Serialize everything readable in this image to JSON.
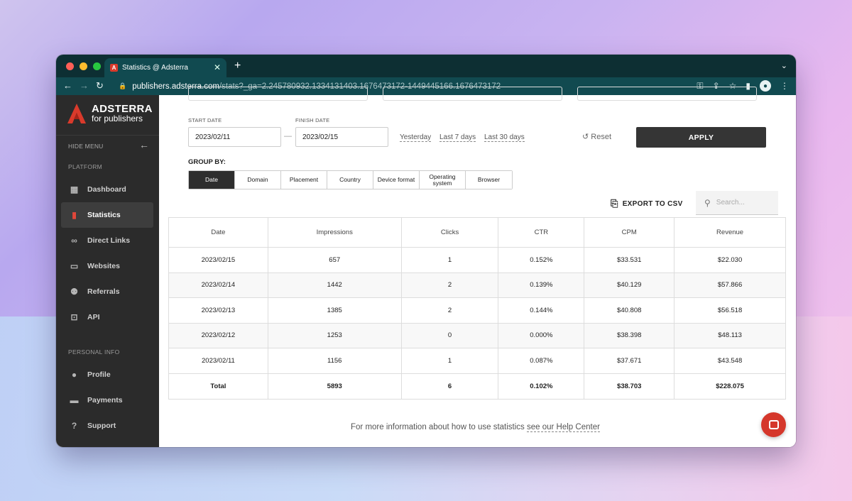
{
  "browser": {
    "tab_title": "Statistics @ Adsterra",
    "tab_favicon": "A",
    "url_host": "publishers.adsterra.com",
    "url_path": "/stats?_ga=2.245780932.1334131403.1676473172-1449445166.1676473172"
  },
  "sidebar": {
    "logo_name": "ADSTERRA",
    "logo_sub": "for publishers",
    "hide_menu": "HIDE MENU",
    "platform_label": "PLATFORM",
    "platform_items": [
      {
        "label": "Dashboard",
        "icon": "dashboard-icon"
      },
      {
        "label": "Statistics",
        "icon": "bar-chart-icon"
      },
      {
        "label": "Direct Links",
        "icon": "link-icon"
      },
      {
        "label": "Websites",
        "icon": "monitor-icon"
      },
      {
        "label": "Referrals",
        "icon": "users-icon"
      },
      {
        "label": "API",
        "icon": "terminal-icon"
      }
    ],
    "personal_label": "PERSONAL INFO",
    "personal_items": [
      {
        "label": "Profile",
        "icon": "user-circle-icon"
      },
      {
        "label": "Payments",
        "icon": "credit-card-icon"
      },
      {
        "label": "Support",
        "icon": "help-icon"
      }
    ]
  },
  "filters": {
    "start_label": "START DATE",
    "start_value": "2023/02/11",
    "finish_label": "FINISH DATE",
    "finish_value": "2023/02/15",
    "dash": "—",
    "quick": [
      "Yesterday",
      "Last 7 days",
      "Last 30 days"
    ],
    "reset_label": "Reset",
    "apply_label": "APPLY"
  },
  "group_by": {
    "label": "GROUP BY:",
    "options": [
      "Date",
      "Domain",
      "Placement",
      "Country",
      "Device format",
      "Operating system",
      "Browser"
    ],
    "selected": "Date"
  },
  "actions": {
    "export_label": "EXPORT TO CSV",
    "search_placeholder": "Search..."
  },
  "table": {
    "columns": [
      "Date",
      "Impressions",
      "Clicks",
      "CTR",
      "CPM",
      "Revenue"
    ],
    "rows": [
      [
        "2023/02/15",
        "657",
        "1",
        "0.152%",
        "$33.531",
        "$22.030"
      ],
      [
        "2023/02/14",
        "1442",
        "2",
        "0.139%",
        "$40.129",
        "$57.866"
      ],
      [
        "2023/02/13",
        "1385",
        "2",
        "0.144%",
        "$40.808",
        "$56.518"
      ],
      [
        "2023/02/12",
        "1253",
        "0",
        "0.000%",
        "$38.398",
        "$48.113"
      ],
      [
        "2023/02/11",
        "1156",
        "1",
        "0.087%",
        "$37.671",
        "$43.548"
      ]
    ],
    "total": [
      "Total",
      "5893",
      "6",
      "0.102%",
      "$38.703",
      "$228.075"
    ]
  },
  "footer": {
    "help_text": "For more information about how to use statistics ",
    "help_link": "see our Help Center"
  },
  "colors": {
    "brand_red": "#d93a2b",
    "sidebar_bg": "#2b2b2b",
    "chrome_bg": "#0d2f33"
  }
}
